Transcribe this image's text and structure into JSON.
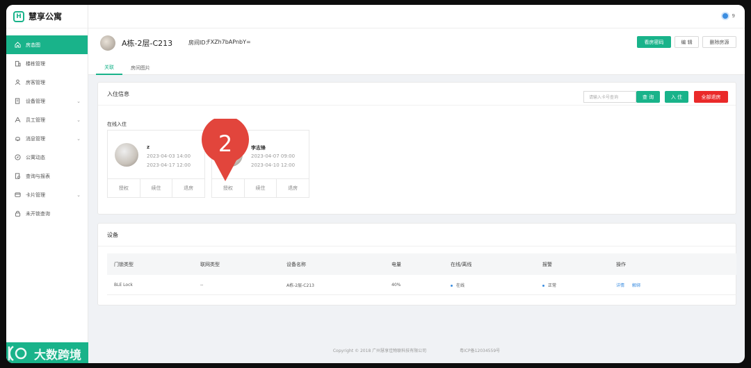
{
  "app": {
    "name": "慧享公寓"
  },
  "sidebar": {
    "items": [
      {
        "label": "房态图",
        "icon": "home-icon"
      },
      {
        "label": "楼栋管理",
        "icon": "building-icon"
      },
      {
        "label": "房客管理",
        "icon": "user-icon"
      },
      {
        "label": "设备管理",
        "icon": "device-icon"
      },
      {
        "label": "员工管理",
        "icon": "staff-icon"
      },
      {
        "label": "消息管理",
        "icon": "bell-icon"
      },
      {
        "label": "公寓动态",
        "icon": "compass-icon"
      },
      {
        "label": "查询与报表",
        "icon": "report-icon"
      },
      {
        "label": "卡片管理",
        "icon": "card-icon"
      },
      {
        "label": "未开锁查询",
        "icon": "lock-icon"
      }
    ]
  },
  "topbar": {
    "user_count": "9"
  },
  "room": {
    "title": "A栋-2层-C213",
    "id_label": "房间ID：",
    "id_value": "FXZh7bAPnbY=",
    "buttons": {
      "view_password": "看房密码",
      "edit": "编 辑",
      "delete": "删除房源"
    },
    "tabs": [
      "关联",
      "房间图片"
    ]
  },
  "checkin": {
    "title": "入住信息",
    "search_placeholder": "请输入卡号查询",
    "query_btn": "查 询",
    "checkin_btn": "入 住",
    "checkout_all_btn": "全部退房",
    "subtitle": "在线入住",
    "tenants": [
      {
        "name": "z",
        "start": "2023-04-03 14:00",
        "end": "2023-04-17 12:00",
        "actions": [
          "授权",
          "续住",
          "退房"
        ]
      },
      {
        "name": "李志锋",
        "start": "2023-04-07 09:00",
        "end": "2023-04-10 12:00",
        "actions": [
          "授权",
          "续住",
          "退房"
        ]
      }
    ]
  },
  "devices": {
    "title": "设备",
    "columns": [
      "门锁类型",
      "联网类型",
      "设备名称",
      "电量",
      "在线/离线",
      "报警",
      "操作"
    ],
    "rows": [
      {
        "lock_type": "BLE Lock",
        "network": "--",
        "name": "A栋-2层-C213",
        "battery": "40%",
        "online": "在线",
        "alarm": "正常",
        "actions": [
          "详情",
          "解绑"
        ]
      }
    ]
  },
  "footer": {
    "copyright": "Copyright © 2018 广州慧享佳物联科技有限公司",
    "icp": "粤ICP备12034559号"
  },
  "marker": {
    "number": "2"
  },
  "watermark": {
    "text": "大数跨境"
  },
  "colors": {
    "accent": "#19b38a",
    "danger": "#ea2a2a",
    "link": "#3b8de0"
  }
}
